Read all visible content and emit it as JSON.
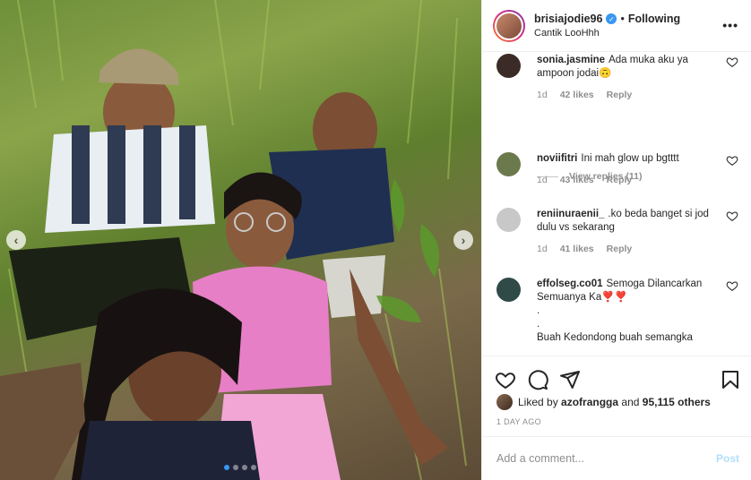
{
  "photo": {
    "description_icon": "photo",
    "carousel_prev_icon": "chevron-left-icon",
    "carousel_next_icon": "chevron-right-icon",
    "carousel_slides": 4,
    "carousel_active_index": 0
  },
  "header": {
    "username": "brisiajodie96",
    "verified_icon": "verified-badge-icon",
    "separator": "•",
    "follow_status": "Following",
    "subtitle": "Cantik LooHhh",
    "more_icon": "more-horizontal-icon",
    "more_label": "•••"
  },
  "comments": [
    {
      "user": "sonia.jasmine",
      "text": "Ada muka aku ya ampoon jodai🙃",
      "age": "1d",
      "likes": "42 likes",
      "reply": "Reply",
      "avatar_color": "#3b2b26"
    },
    {
      "user": "noviifitri",
      "text": "Ini mah glow up bgtttt",
      "age": "1d",
      "likes": "43 likes",
      "reply": "Reply",
      "avatar_color": "#6b7a4c"
    },
    {
      "user": "reniinuraenii_",
      "text": ".ko beda banget si jod dulu vs sekarang",
      "age": "1d",
      "likes": "41 likes",
      "reply": "Reply",
      "avatar_color": "#c8c8c8"
    },
    {
      "user": "effolseg.co01",
      "text": "Semoga Dilancarkan Semuanya Ka❣️❣️",
      "extra_lines": [
        ".",
        ".",
        "Buah Kedondong buah semangka"
      ],
      "avatar_color": "#2f4a47"
    }
  ],
  "view_replies": "View replies (11)",
  "actions": {
    "like_icon": "heart-icon",
    "comment_icon": "comment-icon",
    "share_icon": "paper-plane-icon",
    "save_icon": "bookmark-icon"
  },
  "likes": {
    "prefix": "Liked by",
    "user": "azofrangga",
    "middle": "and",
    "count": "95,115 others"
  },
  "timestamp": "1 DAY AGO",
  "add_comment": {
    "placeholder": "Add a comment...",
    "post_label": "Post"
  },
  "colors": {
    "accent": "#3897f0",
    "post_disabled": "#b2dffc",
    "muted": "#8e8e8e"
  }
}
